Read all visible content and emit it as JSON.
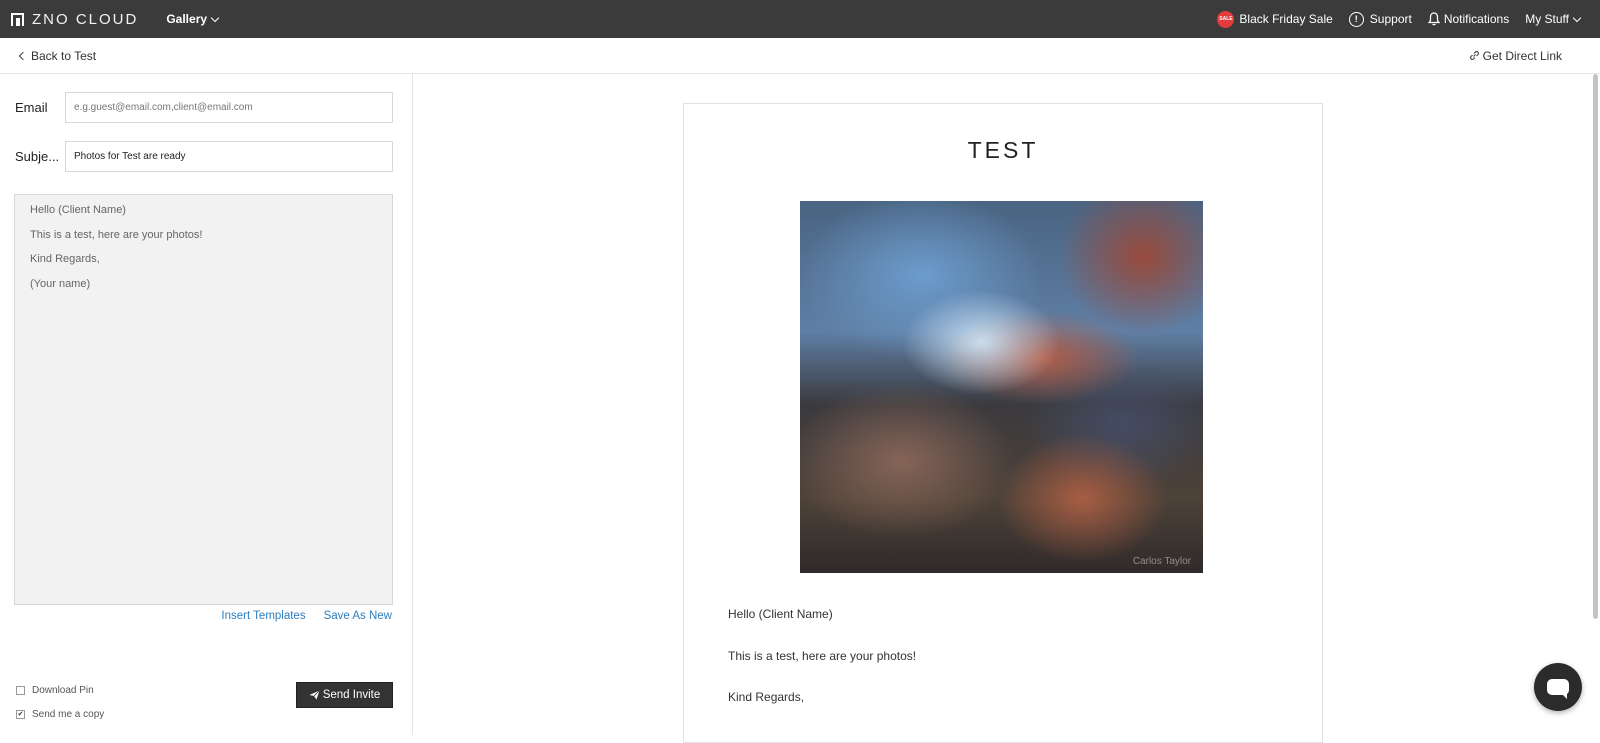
{
  "topbar": {
    "logo_text": "ZNO CLOUD",
    "gallery_label": "Gallery",
    "sale_badge": "SALE",
    "black_friday": "Black Friday Sale",
    "support": "Support",
    "notifications": "Notifications",
    "my_stuff": "My Stuff"
  },
  "subbar": {
    "back": "Back to Test",
    "direct_link": "Get Direct Link"
  },
  "form": {
    "email_label": "Email",
    "email_placeholder": "e.g.guest@email.com,client@email.com",
    "subject_label": "Subje...",
    "subject_value": "Photos for Test are ready",
    "body_lines": [
      "Hello (Client Name)",
      "This is a test, here are your photos!",
      "Kind Regards,",
      "(Your name)"
    ],
    "insert_templates": "Insert Templates",
    "save_as_new": "Save As New",
    "download_pin": "Download Pin",
    "send_copy": "Send me a copy",
    "send_invite": "Send Invite"
  },
  "preview": {
    "title": "TEST",
    "watermark": "Carlos Taylor",
    "lines": [
      "Hello (Client Name)",
      "This is a test, here are your photos!",
      "Kind Regards,"
    ]
  },
  "colors": {
    "topbar": "#3b3b3b",
    "link": "#2d7dbd",
    "button": "#333333",
    "sale": "#e23b3b"
  }
}
